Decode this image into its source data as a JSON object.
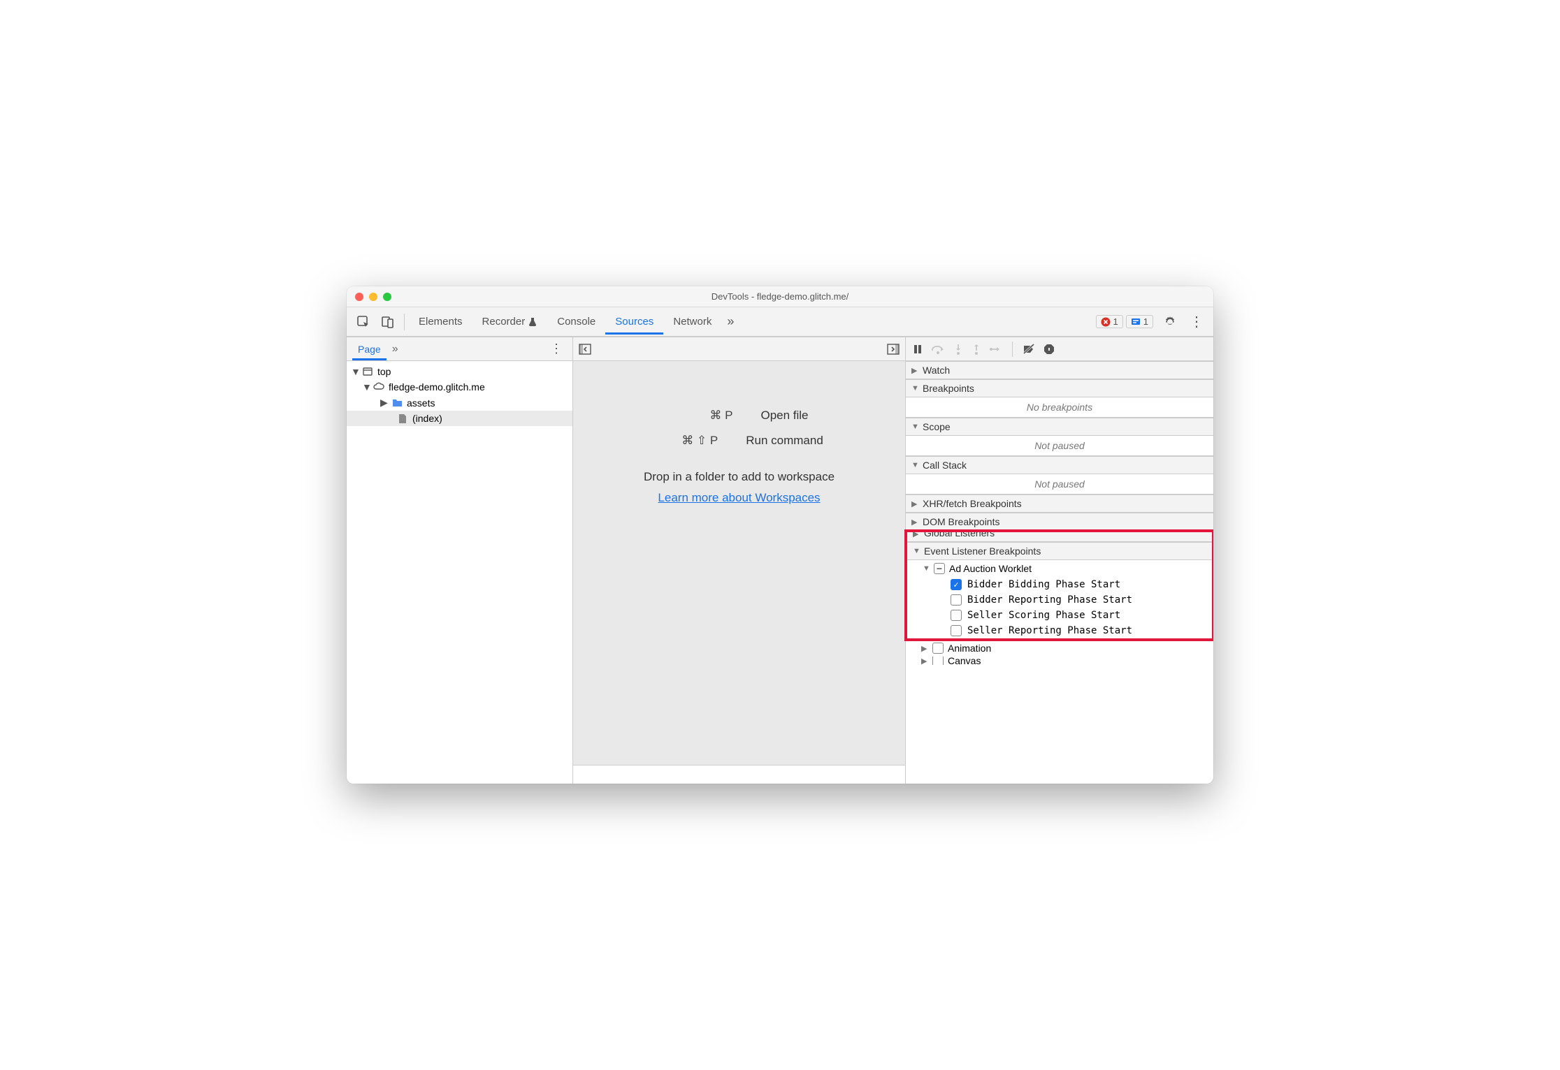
{
  "window": {
    "title": "DevTools - fledge-demo.glitch.me/"
  },
  "tabs": {
    "items": [
      "Elements",
      "Recorder",
      "Console",
      "Sources",
      "Network"
    ],
    "active": "Sources"
  },
  "badges": {
    "error_count": "1",
    "issues_count": "1"
  },
  "navigator": {
    "tab": "Page",
    "tree": {
      "top": "top",
      "origin": "fledge-demo.glitch.me",
      "folder": "assets",
      "file": "(index)"
    }
  },
  "editor": {
    "open_file_key": "⌘ P",
    "open_file_label": "Open file",
    "run_cmd_key": "⌘ ⇧ P",
    "run_cmd_label": "Run command",
    "drop_text": "Drop in a folder to add to workspace",
    "link_text": "Learn more about Workspaces"
  },
  "debugger": {
    "sections": {
      "watch": "Watch",
      "breakpoints": "Breakpoints",
      "breakpoints_empty": "No breakpoints",
      "scope": "Scope",
      "scope_empty": "Not paused",
      "callstack": "Call Stack",
      "callstack_empty": "Not paused",
      "xhr": "XHR/fetch Breakpoints",
      "dom": "DOM Breakpoints",
      "global": "Global Listeners",
      "event_listener": "Event Listener Breakpoints"
    },
    "ad_auction": {
      "label": "Ad Auction Worklet",
      "items": [
        {
          "label": "Bidder Bidding Phase Start",
          "checked": true
        },
        {
          "label": "Bidder Reporting Phase Start",
          "checked": false
        },
        {
          "label": "Seller Scoring Phase Start",
          "checked": false
        },
        {
          "label": "Seller Reporting Phase Start",
          "checked": false
        }
      ]
    },
    "animation": "Animation",
    "canvas": "Canvas"
  }
}
